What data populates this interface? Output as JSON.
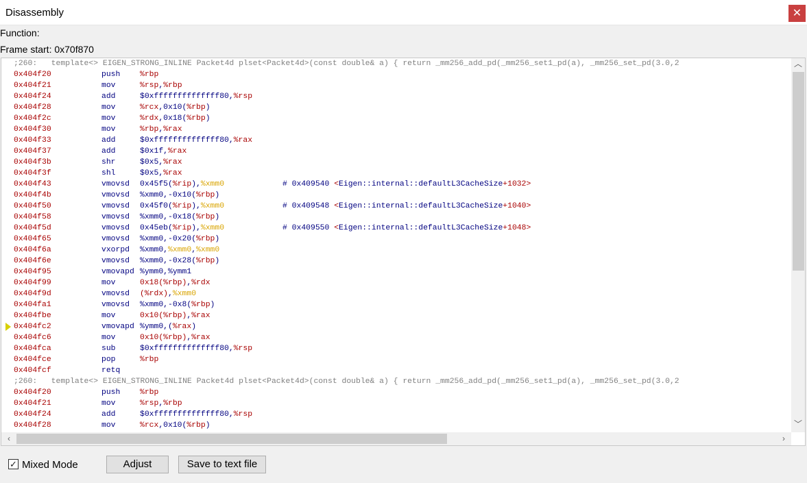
{
  "window": {
    "title": "Disassembly",
    "close_glyph": "✕"
  },
  "info": {
    "function_label": "Function:",
    "frame_start": "Frame start: 0x70f870"
  },
  "source_line": ";260:   template<> EIGEN_STRONG_INLINE Packet4d plset<Packet4d>(const double& a) { return _mm256_add_pd(_mm256_set1_pd(a), _mm256_set_pd(3.0,2",
  "lines": [
    {
      "type": "src"
    },
    {
      "addr": "0x404f20",
      "mnem": "push",
      "ops": [
        [
          "reg",
          "%rbp"
        ]
      ]
    },
    {
      "addr": "0x404f21",
      "mnem": "mov",
      "ops": [
        [
          "reg",
          "%rsp"
        ],
        [
          "t",
          ","
        ],
        [
          "reg",
          "%rbp"
        ]
      ]
    },
    {
      "addr": "0x404f24",
      "mnem": "add",
      "ops": [
        [
          "t",
          "$0xffffffffffffff80,"
        ],
        [
          "reg",
          "%rsp"
        ]
      ]
    },
    {
      "addr": "0x404f28",
      "mnem": "mov",
      "ops": [
        [
          "reg",
          "%rcx"
        ],
        [
          "t",
          ",0x10("
        ],
        [
          "reg",
          "%rbp"
        ],
        [
          "t",
          ")"
        ]
      ]
    },
    {
      "addr": "0x404f2c",
      "mnem": "mov",
      "ops": [
        [
          "reg",
          "%rdx"
        ],
        [
          "t",
          ",0x18("
        ],
        [
          "reg",
          "%rbp"
        ],
        [
          "t",
          ")"
        ]
      ]
    },
    {
      "addr": "0x404f30",
      "mnem": "mov",
      "ops": [
        [
          "reg",
          "%rbp"
        ],
        [
          "t",
          ","
        ],
        [
          "reg",
          "%rax"
        ]
      ]
    },
    {
      "addr": "0x404f33",
      "mnem": "add",
      "ops": [
        [
          "t",
          "$0xffffffffffffff80,"
        ],
        [
          "reg",
          "%rax"
        ]
      ]
    },
    {
      "addr": "0x404f37",
      "mnem": "add",
      "ops": [
        [
          "t",
          "$0x1f,"
        ],
        [
          "reg",
          "%rax"
        ]
      ]
    },
    {
      "addr": "0x404f3b",
      "mnem": "shr",
      "ops": [
        [
          "t",
          "$0x5,"
        ],
        [
          "reg",
          "%rax"
        ]
      ]
    },
    {
      "addr": "0x404f3f",
      "mnem": "shl",
      "ops": [
        [
          "t",
          "$0x5,"
        ],
        [
          "reg",
          "%rax"
        ]
      ]
    },
    {
      "addr": "0x404f43",
      "mnem": "vmovsd",
      "ops": [
        [
          "t",
          "0x45f5("
        ],
        [
          "reg",
          "%rip"
        ],
        [
          "t",
          "),"
        ],
        [
          "xmm",
          "%xmm0"
        ]
      ],
      "cmt": [
        [
          "t",
          "# 0x409540 "
        ],
        [
          "reg",
          "<"
        ],
        [
          "t",
          "Eigen::internal::defaultL3CacheSize"
        ],
        [
          "reg",
          "+1032>"
        ]
      ]
    },
    {
      "addr": "0x404f4b",
      "mnem": "vmovsd",
      "ops": [
        [
          "t",
          "%xmm0,-0x10("
        ],
        [
          "reg",
          "%rbp"
        ],
        [
          "t",
          ")"
        ]
      ]
    },
    {
      "addr": "0x404f50",
      "mnem": "vmovsd",
      "ops": [
        [
          "t",
          "0x45f0("
        ],
        [
          "reg",
          "%rip"
        ],
        [
          "t",
          "),"
        ],
        [
          "xmm",
          "%xmm0"
        ]
      ],
      "cmt": [
        [
          "t",
          "# 0x409548 "
        ],
        [
          "reg",
          "<"
        ],
        [
          "t",
          "Eigen::internal::defaultL3CacheSize"
        ],
        [
          "reg",
          "+1040>"
        ]
      ]
    },
    {
      "addr": "0x404f58",
      "mnem": "vmovsd",
      "ops": [
        [
          "t",
          "%xmm0,-0x18("
        ],
        [
          "reg",
          "%rbp"
        ],
        [
          "t",
          ")"
        ]
      ]
    },
    {
      "addr": "0x404f5d",
      "mnem": "vmovsd",
      "ops": [
        [
          "t",
          "0x45eb("
        ],
        [
          "reg",
          "%rip"
        ],
        [
          "t",
          "),"
        ],
        [
          "xmm",
          "%xmm0"
        ]
      ],
      "cmt": [
        [
          "t",
          "# 0x409550 "
        ],
        [
          "reg",
          "<"
        ],
        [
          "t",
          "Eigen::internal::defaultL3CacheSize"
        ],
        [
          "reg",
          "+1048>"
        ]
      ]
    },
    {
      "addr": "0x404f65",
      "mnem": "vmovsd",
      "ops": [
        [
          "t",
          "%xmm0,-0x20("
        ],
        [
          "reg",
          "%rbp"
        ],
        [
          "t",
          ")"
        ]
      ]
    },
    {
      "addr": "0x404f6a",
      "mnem": "vxorpd",
      "ops": [
        [
          "t",
          "%xmm0,"
        ],
        [
          "xmm",
          "%xmm0"
        ],
        [
          "t",
          ","
        ],
        [
          "xmm",
          "%xmm0"
        ]
      ]
    },
    {
      "addr": "0x404f6e",
      "mnem": "vmovsd",
      "ops": [
        [
          "t",
          "%xmm0,-0x28("
        ],
        [
          "reg",
          "%rbp"
        ],
        [
          "t",
          ")"
        ]
      ]
    },
    {
      "addr": "0x404f95",
      "mnem": "vmovapd",
      "ops": [
        [
          "t",
          "%ymm0,%ymm1"
        ]
      ]
    },
    {
      "addr": "0x404f99",
      "mnem": "mov",
      "ops": [
        [
          "reg",
          "0x18(%rbp)"
        ],
        [
          "t",
          ","
        ],
        [
          "reg",
          "%rdx"
        ]
      ]
    },
    {
      "addr": "0x404f9d",
      "mnem": "vmovsd",
      "ops": [
        [
          "reg",
          "(%rdx)"
        ],
        [
          "t",
          ","
        ],
        [
          "xmm",
          "%xmm0"
        ]
      ]
    },
    {
      "addr": "0x404fa1",
      "mnem": "vmovsd",
      "ops": [
        [
          "t",
          "%xmm0,-0x8("
        ],
        [
          "reg",
          "%rbp"
        ],
        [
          "t",
          ")"
        ]
      ]
    },
    {
      "addr": "0x404fbe",
      "mnem": "mov",
      "ops": [
        [
          "reg",
          "0x10(%rbp)"
        ],
        [
          "t",
          ","
        ],
        [
          "reg",
          "%rax"
        ]
      ]
    },
    {
      "addr": "0x404fc2",
      "mnem": "vmovapd",
      "ops": [
        [
          "t",
          "%ymm0,("
        ],
        [
          "reg",
          "%rax"
        ],
        [
          "t",
          ")"
        ]
      ],
      "current": true
    },
    {
      "addr": "0x404fc6",
      "mnem": "mov",
      "ops": [
        [
          "reg",
          "0x10(%rbp)"
        ],
        [
          "t",
          ","
        ],
        [
          "reg",
          "%rax"
        ]
      ]
    },
    {
      "addr": "0x404fca",
      "mnem": "sub",
      "ops": [
        [
          "t",
          "$0xffffffffffffff80,"
        ],
        [
          "reg",
          "%rsp"
        ]
      ]
    },
    {
      "addr": "0x404fce",
      "mnem": "pop",
      "ops": [
        [
          "reg",
          "%rbp"
        ]
      ]
    },
    {
      "addr": "0x404fcf",
      "mnem": "retq",
      "ops": []
    },
    {
      "type": "src"
    },
    {
      "addr": "0x404f20",
      "mnem": "push",
      "ops": [
        [
          "reg",
          "%rbp"
        ]
      ]
    },
    {
      "addr": "0x404f21",
      "mnem": "mov",
      "ops": [
        [
          "reg",
          "%rsp"
        ],
        [
          "t",
          ","
        ],
        [
          "reg",
          "%rbp"
        ]
      ]
    },
    {
      "addr": "0x404f24",
      "mnem": "add",
      "ops": [
        [
          "t",
          "$0xffffffffffffff80,"
        ],
        [
          "reg",
          "%rsp"
        ]
      ]
    },
    {
      "addr": "0x404f28",
      "mnem": "mov",
      "ops": [
        [
          "reg",
          "%rcx"
        ],
        [
          "t",
          ",0x10("
        ],
        [
          "reg",
          "%rbp"
        ],
        [
          "t",
          ")"
        ]
      ]
    }
  ],
  "footer": {
    "mixed_mode_checked": true,
    "mixed_mode_label": "Mixed Mode",
    "adjust_label": "Adjust",
    "save_label": "Save to text file"
  },
  "icons": {
    "close": "close-icon",
    "scroll_up": "chevron-up-icon",
    "scroll_down": "chevron-down-icon",
    "scroll_left": "chevron-left-icon",
    "scroll_right": "chevron-right-icon",
    "check": "checkmark-icon",
    "current_line": "current-instruction-arrow-icon"
  },
  "colors": {
    "address": "#a80000",
    "instruction": "#000080",
    "source_comment": "#808080",
    "register": "#a80000",
    "xmm_register": "#d9a400",
    "close_button": "#c94040"
  }
}
